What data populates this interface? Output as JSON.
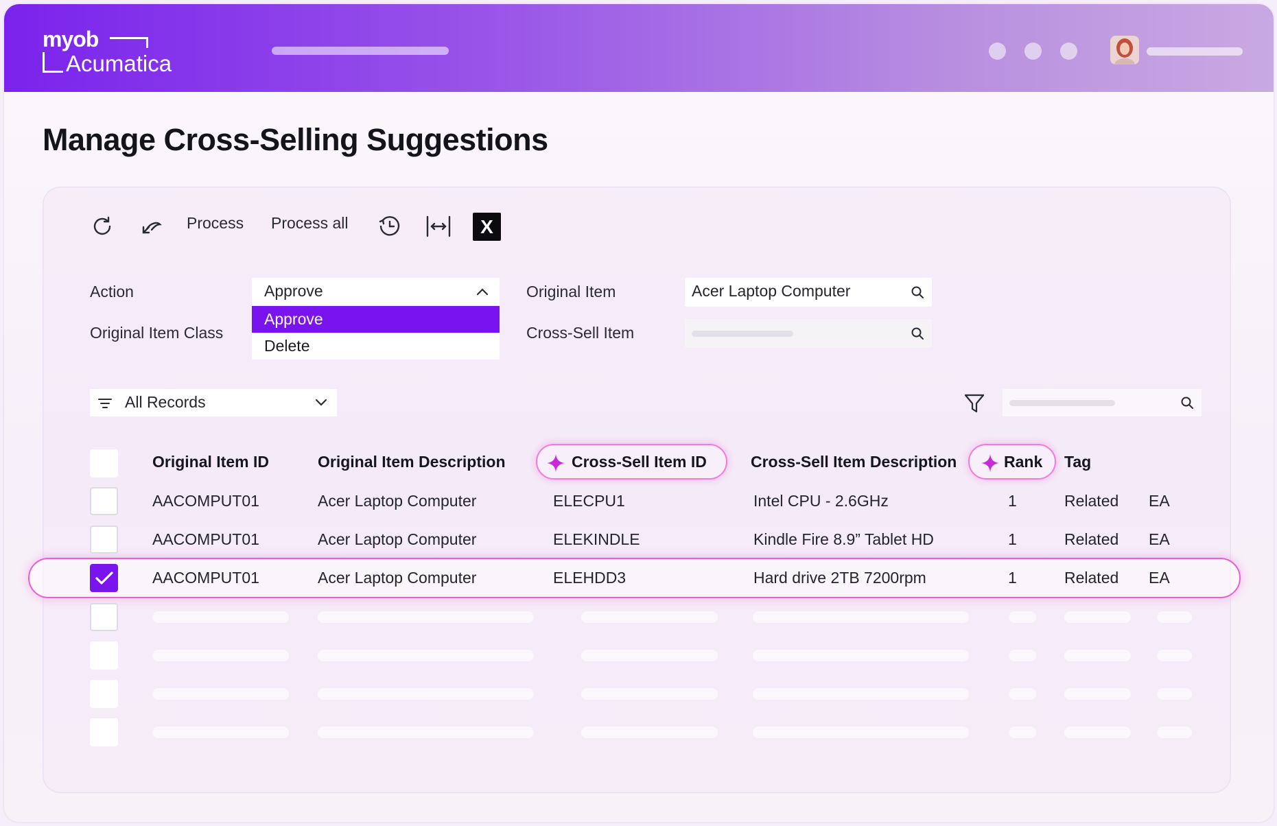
{
  "brand": {
    "line1": "myob",
    "line2": "Acumatica"
  },
  "page": {
    "title": "Manage Cross-Selling Suggestions"
  },
  "toolbar": {
    "refresh_icon": "refresh-icon",
    "undo_icon": "undo-icon",
    "process_label": "Process",
    "process_all_label": "Process all",
    "schedule_icon": "clock-icon",
    "fit_icon": "fit-columns-icon",
    "excel_label": "X"
  },
  "form": {
    "action_label": "Action",
    "action_value": "Approve",
    "action_options": [
      "Approve",
      "Delete"
    ],
    "original_item_class_label": "Original Item Class",
    "original_item_label": "Original Item",
    "original_item_value": "Acer Laptop Computer",
    "cross_sell_item_label": "Cross-Sell Item"
  },
  "grid": {
    "filter_label": "All Records",
    "columns": [
      "Original Item ID",
      "Original Item Description",
      "Cross-Sell Item ID",
      "Cross-Sell Item Description",
      "Rank",
      "Tag"
    ],
    "rows": [
      {
        "selected": false,
        "cells": [
          "AACOMPUT01",
          "Acer Laptop Computer",
          "ELECPU1",
          "Intel CPU - 2.6GHz",
          "1",
          "Related",
          "EA"
        ]
      },
      {
        "selected": false,
        "cells": [
          "AACOMPUT01",
          "Acer Laptop Computer",
          "ELEKINDLE",
          "Kindle Fire 8.9” Tablet HD",
          "1",
          "Related",
          "EA"
        ]
      },
      {
        "selected": true,
        "cells": [
          "AACOMPUT01",
          "Acer Laptop Computer",
          "ELEHDD3",
          "Hard drive 2TB 7200rpm",
          "1",
          "Related",
          "EA"
        ]
      }
    ]
  },
  "colors": {
    "accent": "#7a14ee",
    "ai_highlight": "#ea5fd0",
    "header_start": "#7a23ec",
    "header_end": "#c9a9e2"
  }
}
